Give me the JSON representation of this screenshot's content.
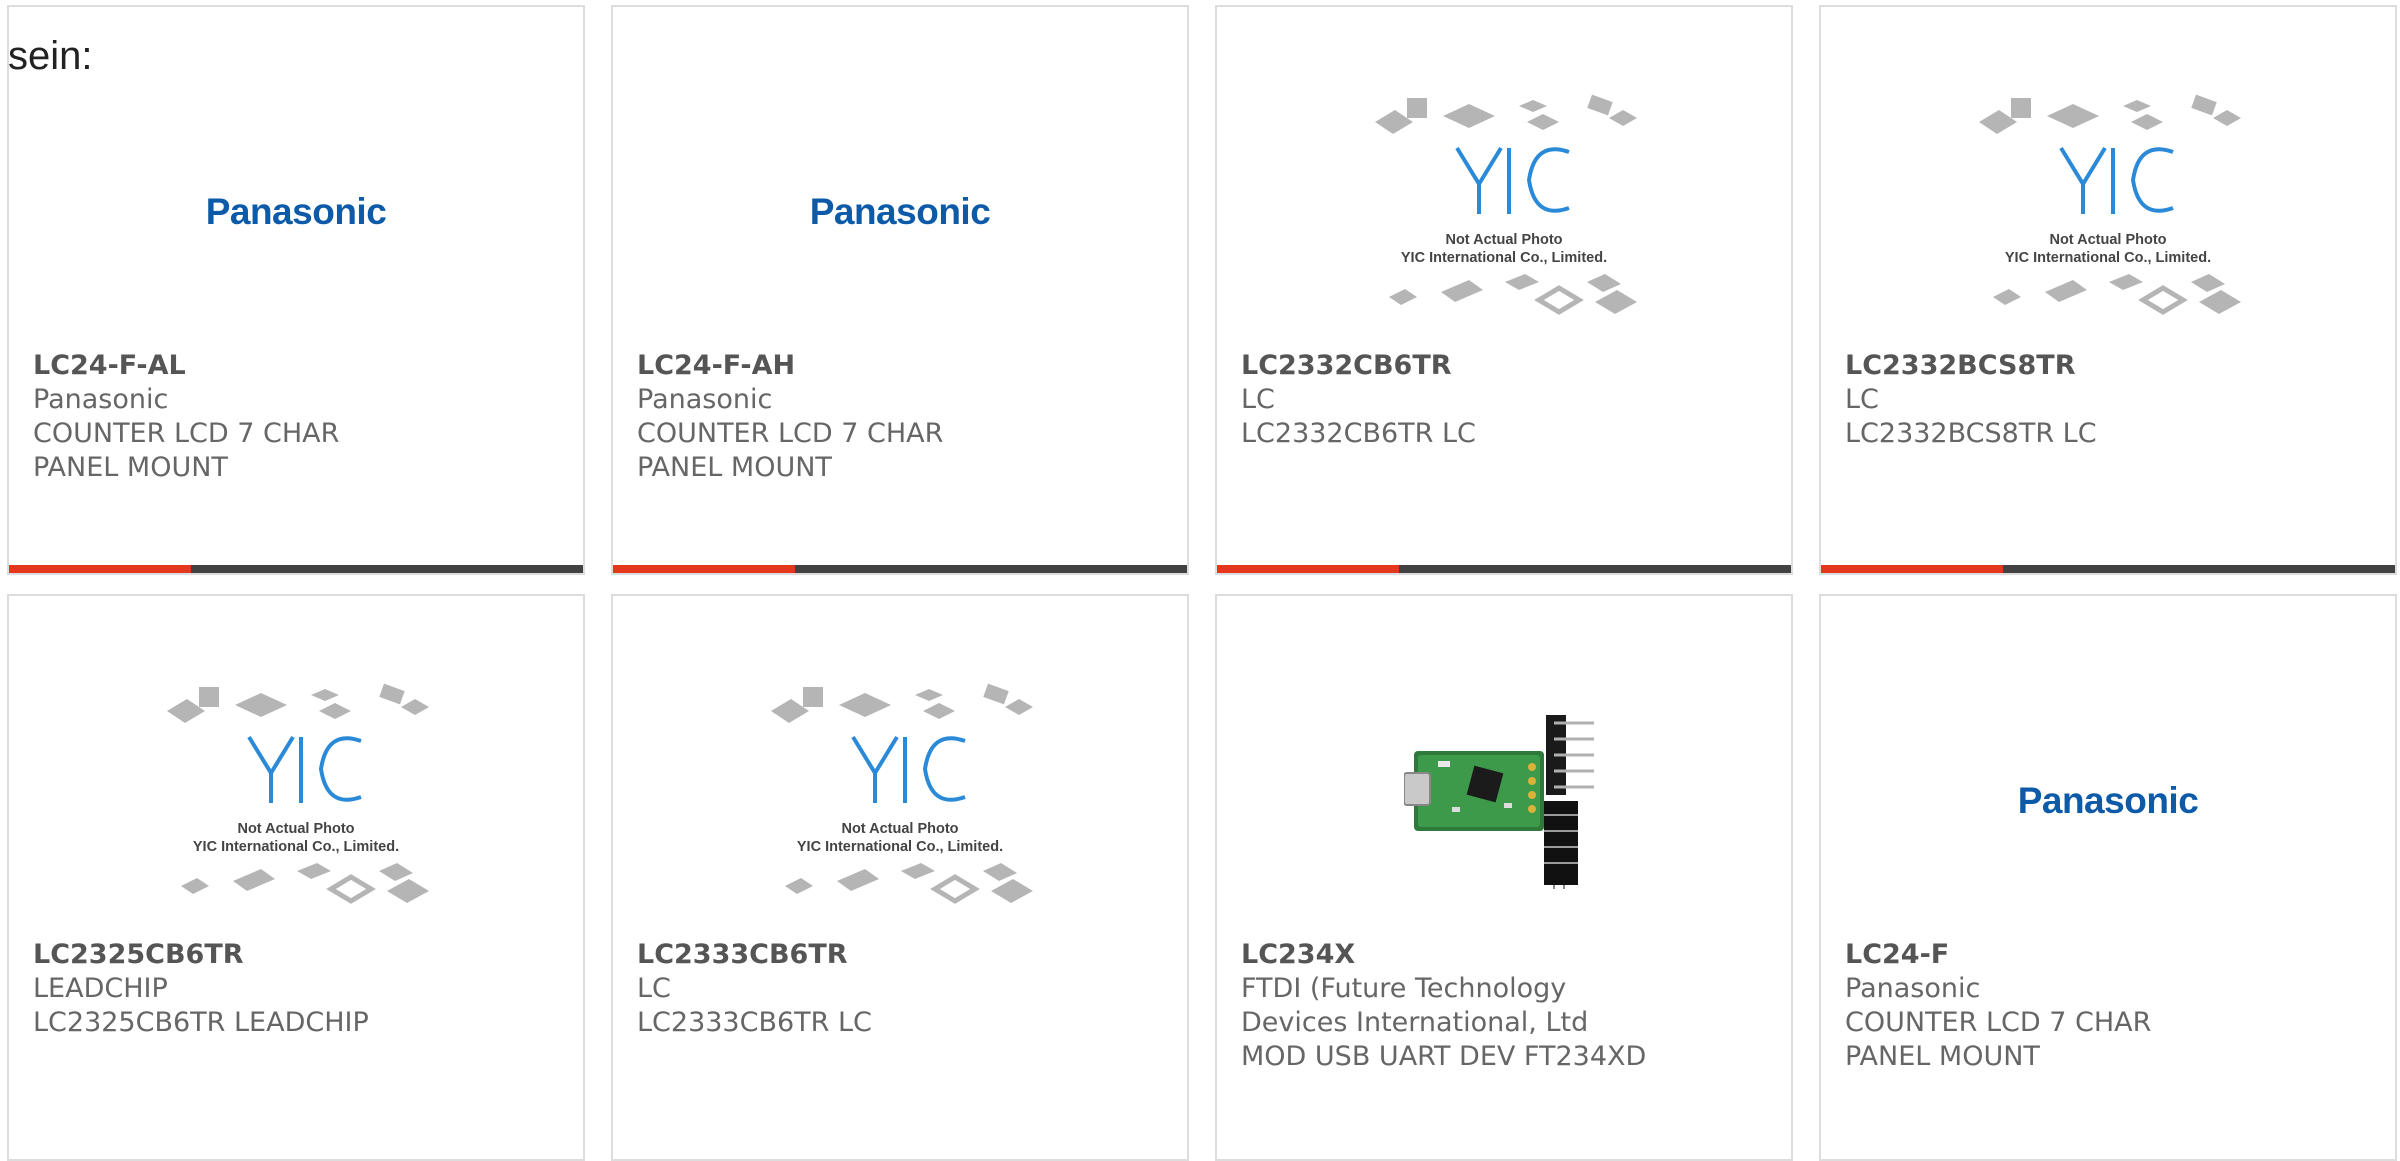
{
  "intro_text": "sein:",
  "colors": {
    "accent": "#e4381e",
    "bar": "#424242",
    "panasonic_blue": "#0c5aa8",
    "yic_blue": "#2a8ad8"
  },
  "products": [
    {
      "part_number": "LC24-F-AL",
      "manufacturer": "Panasonic",
      "description": "COUNTER LCD 7 CHAR PANEL MOUNT",
      "image": "brand-logo",
      "logo_text": "Panasonic"
    },
    {
      "part_number": "LC24-F-AH",
      "manufacturer": "Panasonic",
      "description": "COUNTER LCD 7 CHAR PANEL MOUNT",
      "image": "brand-logo",
      "logo_text": "Panasonic"
    },
    {
      "part_number": "LC2332CB6TR",
      "manufacturer": "LC",
      "description": "LC2332CB6TR LC",
      "image": "placeholder",
      "placeholder_line1": "Not Actual Photo",
      "placeholder_line2": "YIC International Co., Limited."
    },
    {
      "part_number": "LC2332BCS8TR",
      "manufacturer": "LC",
      "description": "LC2332BCS8TR LC",
      "image": "placeholder",
      "placeholder_line1": "Not Actual Photo",
      "placeholder_line2": "YIC International Co., Limited."
    },
    {
      "part_number": "LC2325CB6TR",
      "manufacturer": "LEADCHIP",
      "description": "LC2325CB6TR LEADCHIP",
      "image": "placeholder",
      "placeholder_line1": "Not Actual Photo",
      "placeholder_line2": "YIC International Co., Limited."
    },
    {
      "part_number": "LC2333CB6TR",
      "manufacturer": "LC",
      "description": "LC2333CB6TR LC",
      "image": "placeholder",
      "placeholder_line1": "Not Actual Photo",
      "placeholder_line2": "YIC International Co., Limited."
    },
    {
      "part_number": "LC234X",
      "manufacturer": "FTDI (Future Technology Devices International, Ltd",
      "description": "MOD USB UART DEV FT234XD",
      "image": "board-photo"
    },
    {
      "part_number": "LC24-F",
      "manufacturer": "Panasonic",
      "description": "COUNTER LCD 7 CHAR PANEL MOUNT",
      "image": "brand-logo",
      "logo_text": "Panasonic"
    }
  ]
}
